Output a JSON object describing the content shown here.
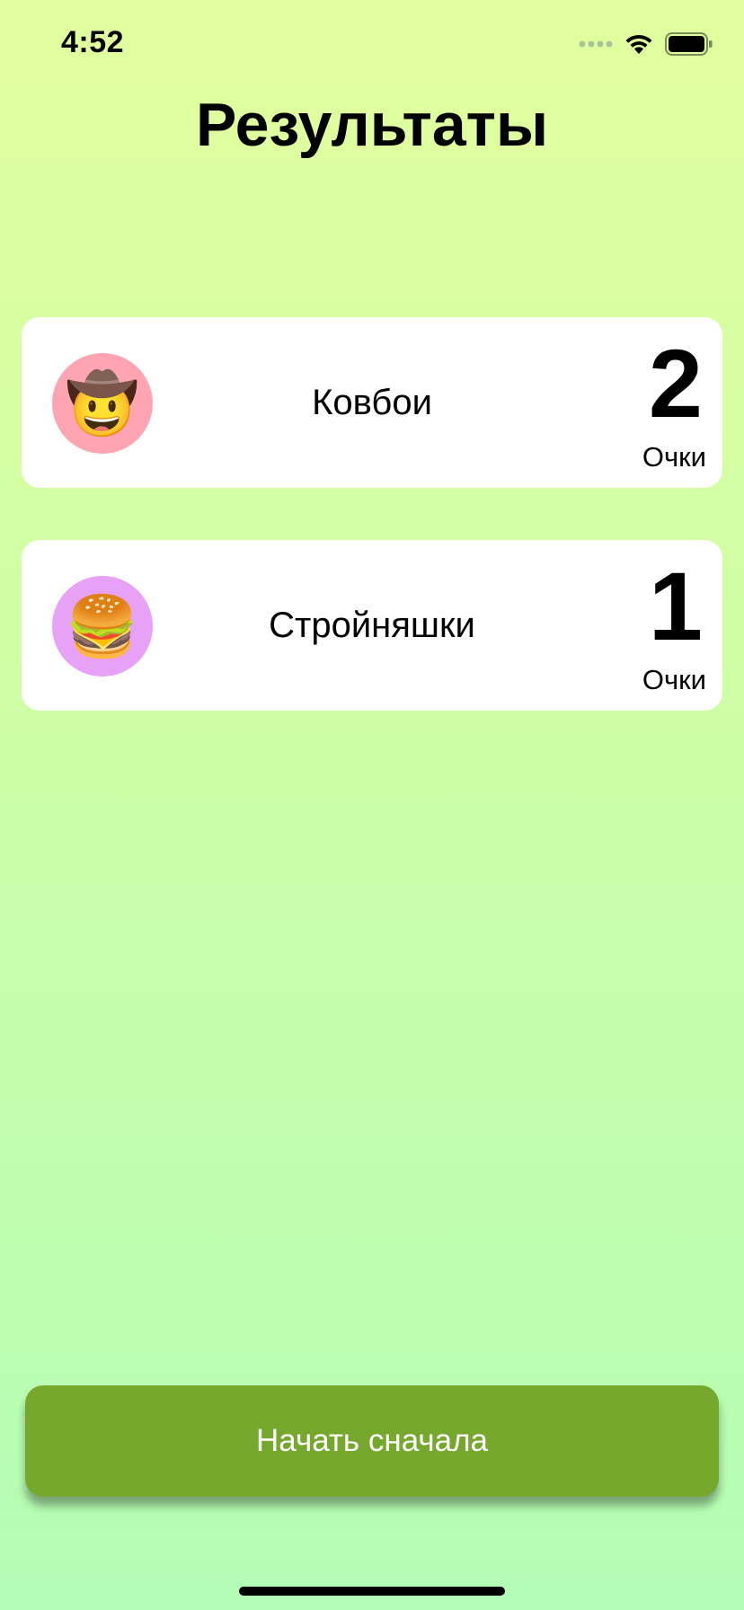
{
  "status_bar": {
    "time": "4:52",
    "icons": [
      "cellular-icon",
      "wifi-icon",
      "battery-icon"
    ]
  },
  "title": "Результаты",
  "teams": [
    {
      "emoji": "🤠",
      "name": "Ковбои",
      "score": "2",
      "score_label": "Очки",
      "avatar_color": "#fea4b2"
    },
    {
      "emoji": "🍔",
      "name": "Стройняшки",
      "score": "1",
      "score_label": "Очки",
      "avatar_color": "#e7a2f7"
    }
  ],
  "restart_label": "Начать сначала",
  "colors": {
    "background_top": "#e2fe9e",
    "background_bottom": "#b4fdb6",
    "button": "#76a82e"
  }
}
